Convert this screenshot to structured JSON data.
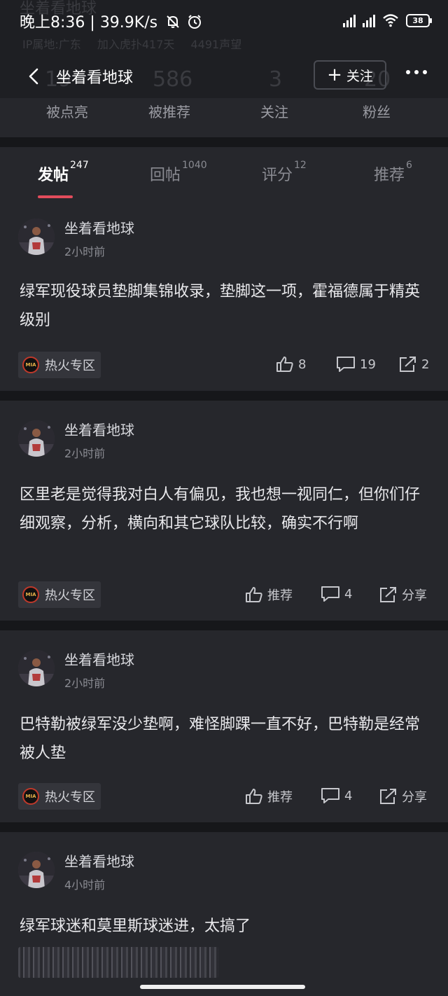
{
  "status_bar": {
    "time": "晚上8:36",
    "speed": "39.9K/s",
    "battery": "38"
  },
  "profile_ghost": {
    "name": "坐着看地球",
    "ip": "IP属地:广东",
    "joined": "加入虎扑417天",
    "reputation": "4491声望",
    "stats": [
      "19",
      "586",
      "3",
      "20"
    ]
  },
  "nav": {
    "title": "坐着看地球",
    "follow": "关注"
  },
  "stats": [
    {
      "label": "被点亮"
    },
    {
      "label": "被推荐"
    },
    {
      "label": "关注"
    },
    {
      "label": "粉丝"
    }
  ],
  "tabs": [
    {
      "label": "发帖",
      "count": "247",
      "active": true
    },
    {
      "label": "回帖",
      "count": "1040",
      "active": false
    },
    {
      "label": "评分",
      "count": "12",
      "active": false
    },
    {
      "label": "推荐",
      "count": "6",
      "active": false
    }
  ],
  "posts": [
    {
      "author": "坐着看地球",
      "time": "2小时前",
      "text": "绿军现役球员垫脚集锦收录，垫脚这一项，霍福德属于精英级别",
      "tag": "热火专区",
      "like": "8",
      "comments": "19",
      "share": "2"
    },
    {
      "author": "坐着看地球",
      "time": "2小时前",
      "text": "区里老是觉得我对白人有偏见，我也想一视同仁，但你们仔细观察，分析，横向和其它球队比较，确实不行啊",
      "tag": "热火专区",
      "like": "推荐",
      "comments": "4",
      "share": "分享"
    },
    {
      "author": "坐着看地球",
      "time": "2小时前",
      "text": "巴特勒被绿军没少垫啊，难怪脚踝一直不好，巴特勒是经常被人垫",
      "tag": "热火专区",
      "like": "推荐",
      "comments": "4",
      "share": "分享"
    },
    {
      "author": "坐着看地球",
      "time": "4小时前",
      "text": "绿军球迷和莫里斯球迷进，太搞了"
    }
  ],
  "tag_logo_text": "MIA"
}
